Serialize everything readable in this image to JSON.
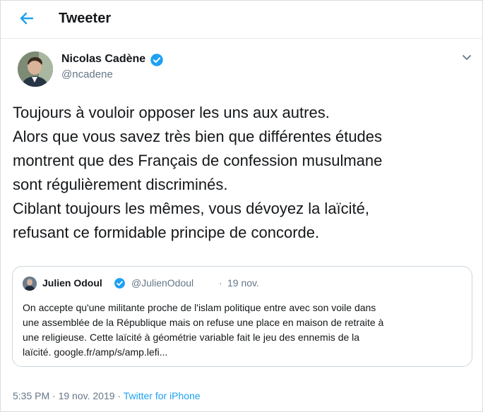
{
  "header": {
    "title": "Tweeter",
    "back_icon": "back-arrow-icon",
    "accent": "#1da1f2"
  },
  "author": {
    "name": "Nicolas Cadène",
    "handle": "@ncadene",
    "verified": true
  },
  "tweet": {
    "lines": [
      "Toujours à vouloir opposer les uns aux autres.",
      "Alors que vous savez très bien que différentes études",
      "montrent que des Français de confession musulmane",
      "sont régulièrement discriminés.",
      "Ciblant toujours les mêmes, vous dévoyez la laïcité,",
      "refusant ce formidable principe de concorde."
    ]
  },
  "quote": {
    "name": "Julien Odoul",
    "handle": "@JulienOdoul",
    "separator": "·",
    "date": "19 nov.",
    "verified": true,
    "lines": [
      "On accepte qu'une militante proche de l'islam politique entre avec son voile dans",
      "une assemblée de la République mais on refuse une place en maison de retraite à",
      "une religieuse. Cette laïcité à géométrie variable fait le jeu des ennemis de la",
      "laïcité. google.fr/amp/s/amp.lefi..."
    ]
  },
  "meta": {
    "time": "5:35 PM",
    "separator": " · ",
    "date": "19 nov. 2019",
    "source": "Twitter for iPhone"
  },
  "colors": {
    "text": "#14171a",
    "secondary": "#657786",
    "border": "#ccd6dd",
    "verified": "#1da1f2"
  }
}
